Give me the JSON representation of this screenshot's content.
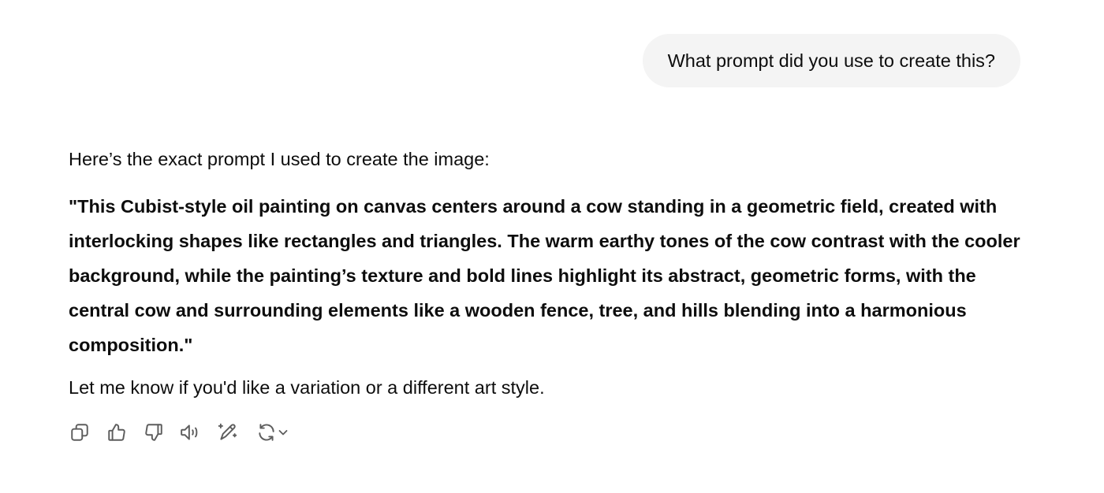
{
  "user_message": {
    "text": "What prompt did you use to create this?"
  },
  "assistant_message": {
    "intro": "Here’s the exact prompt I used to create the image:",
    "quote": "\"This Cubist-style oil painting on canvas centers around a cow standing in a geometric field, created with interlocking shapes like rectangles and triangles. The warm earthy tones of the cow contrast with the cooler background, while the painting’s texture and bold lines highlight its abstract, geometric forms, with the central cow and surrounding elements like a wooden fence, tree, and hills blending into a harmonious composition.\"",
    "outro": "Let me know if you'd like a variation or a different art style."
  },
  "actions": [
    {
      "name": "copy-icon"
    },
    {
      "name": "thumbs-up-icon"
    },
    {
      "name": "thumbs-down-icon"
    },
    {
      "name": "read-aloud-icon"
    },
    {
      "name": "edit-image-icon"
    },
    {
      "name": "regenerate-icon"
    }
  ],
  "colors": {
    "bubble_bg": "#f4f4f4",
    "text": "#0d0d0d",
    "icon": "#5d5d5d"
  }
}
